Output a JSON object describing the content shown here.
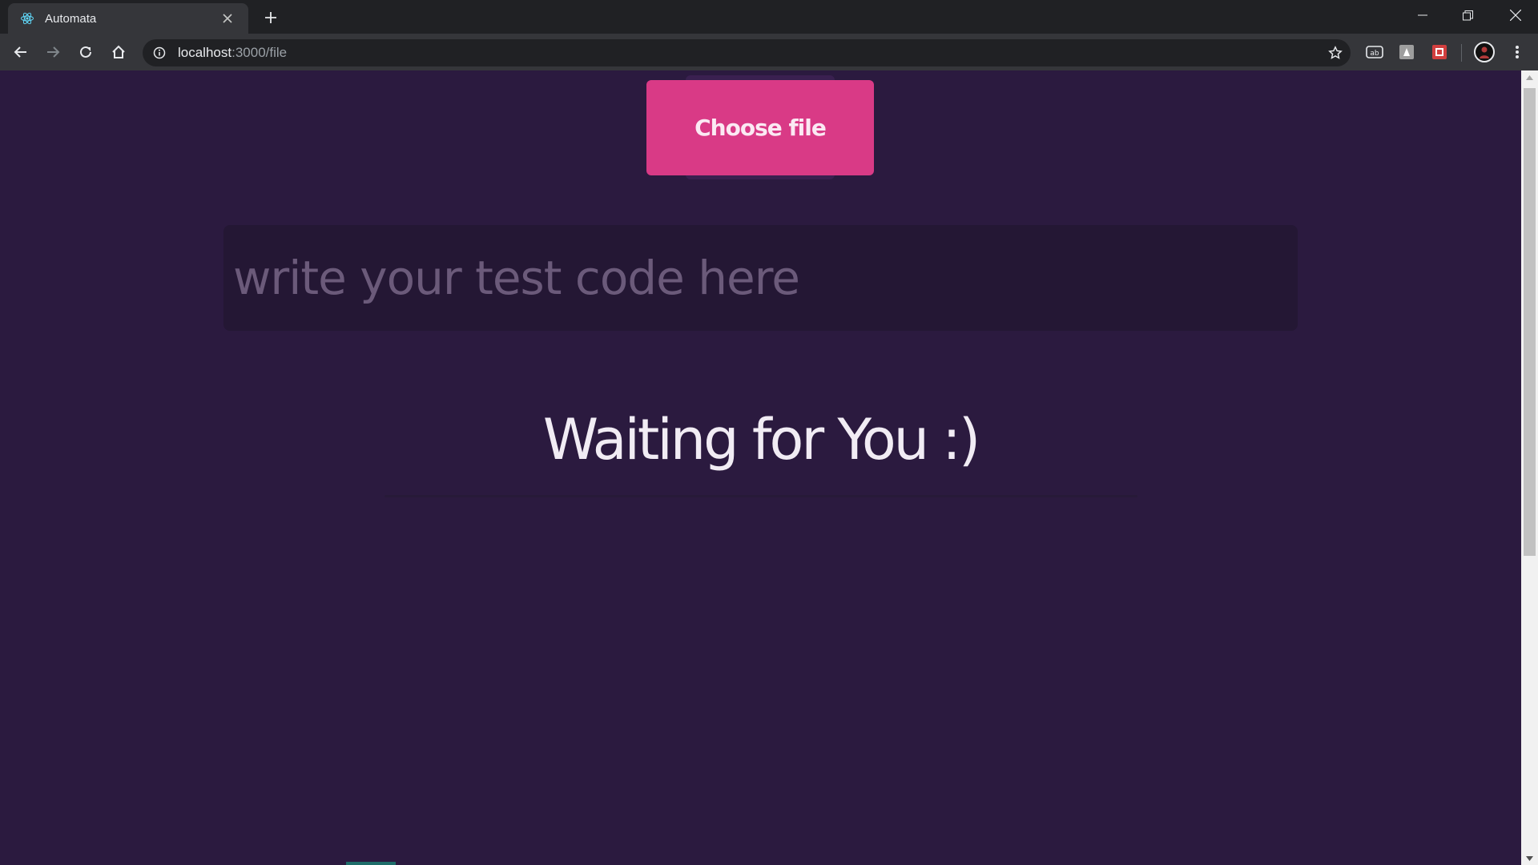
{
  "browser": {
    "tab_title": "Automata",
    "url_host": "localhost",
    "url_path": ":3000/file"
  },
  "page": {
    "choose_file_label": "Choose file",
    "code_input_placeholder": "write your test code here",
    "code_input_value": "",
    "status_text": "Waiting for You :)"
  },
  "icons": {
    "favicon": "react-icon",
    "back": "back-arrow-icon",
    "forward": "forward-arrow-icon",
    "reload": "reload-icon",
    "home": "home-icon",
    "info": "info-icon",
    "bookmark": "star-icon",
    "extensions": [
      "translate-icon",
      "extension-icon",
      "puzzle-extension-icon"
    ],
    "profile": "avatar",
    "menu": "kebab-menu-icon"
  },
  "colors": {
    "page_background": "#2b1a3f",
    "button_accent": "#d93a86",
    "input_background": "#241734"
  }
}
